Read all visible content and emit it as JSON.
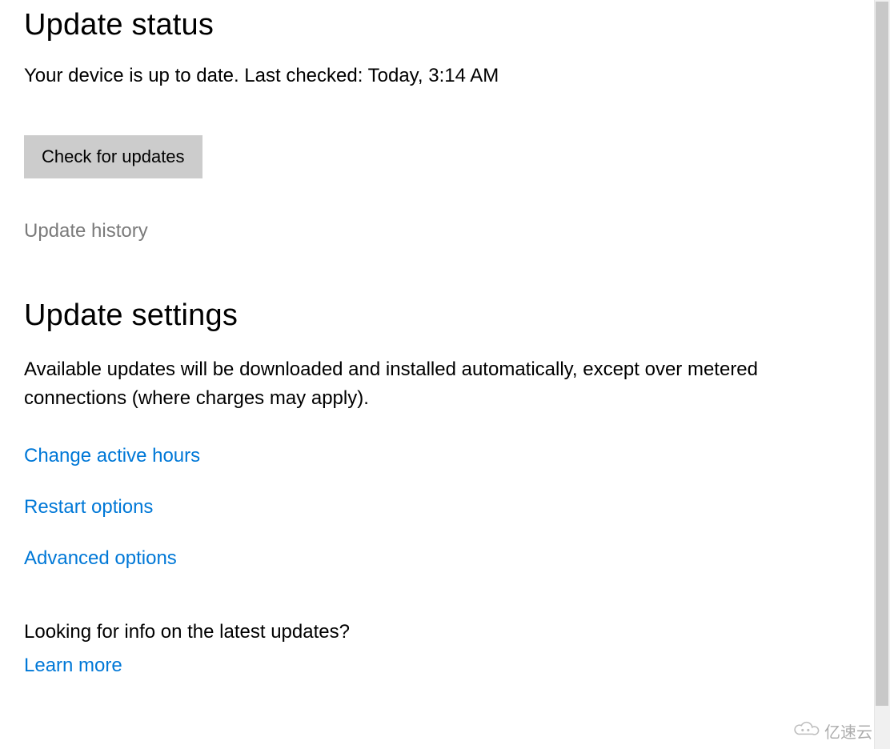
{
  "status": {
    "heading": "Update status",
    "message": "Your device is up to date. Last checked: Today, 3:14 AM",
    "check_button_label": "Check for updates",
    "history_link": "Update history"
  },
  "settings": {
    "heading": "Update settings",
    "description": "Available updates will be downloaded and installed automatically, except over metered connections (where charges may apply).",
    "links": {
      "active_hours": "Change active hours",
      "restart_options": "Restart options",
      "advanced_options": "Advanced options"
    },
    "info_prompt": "Looking for info on the latest updates?",
    "learn_more": "Learn more"
  },
  "watermark": {
    "text": "亿速云"
  },
  "colors": {
    "link": "#0078d7",
    "muted": "#7a7a7a",
    "button_bg": "#cccccc"
  }
}
